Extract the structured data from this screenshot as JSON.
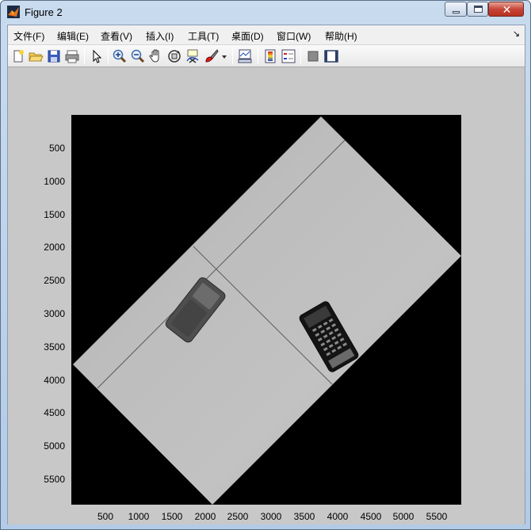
{
  "window": {
    "title": "Figure 2"
  },
  "menu": {
    "items": [
      "文件(F)",
      "编辑(E)",
      "查看(V)",
      "插入(I)",
      "工具(T)",
      "桌面(D)",
      "窗口(W)",
      "帮助(H)"
    ]
  },
  "toolbar": {
    "buttons": [
      "new-figure",
      "open-file",
      "save-figure",
      "print-figure",
      "edit-plot",
      "zoom-in",
      "zoom-out",
      "pan",
      "rotate-3d",
      "data-cursor",
      "brush",
      "brush-dropdown",
      "link-plot",
      "insert-colorbar",
      "insert-legend",
      "hide-plot-tools",
      "show-plot-tools"
    ]
  },
  "axes": {
    "xticks": [
      "500",
      "1000",
      "1500",
      "2000",
      "2500",
      "3000",
      "3500",
      "4000",
      "4500",
      "5000",
      "5500"
    ],
    "yticks": [
      "500",
      "1000",
      "1500",
      "2000",
      "2500",
      "3000",
      "3500",
      "4000",
      "4500",
      "5000",
      "5500"
    ]
  },
  "image": {
    "description_colors": {
      "background": "#000000",
      "paper": "#b9b9b9"
    }
  }
}
